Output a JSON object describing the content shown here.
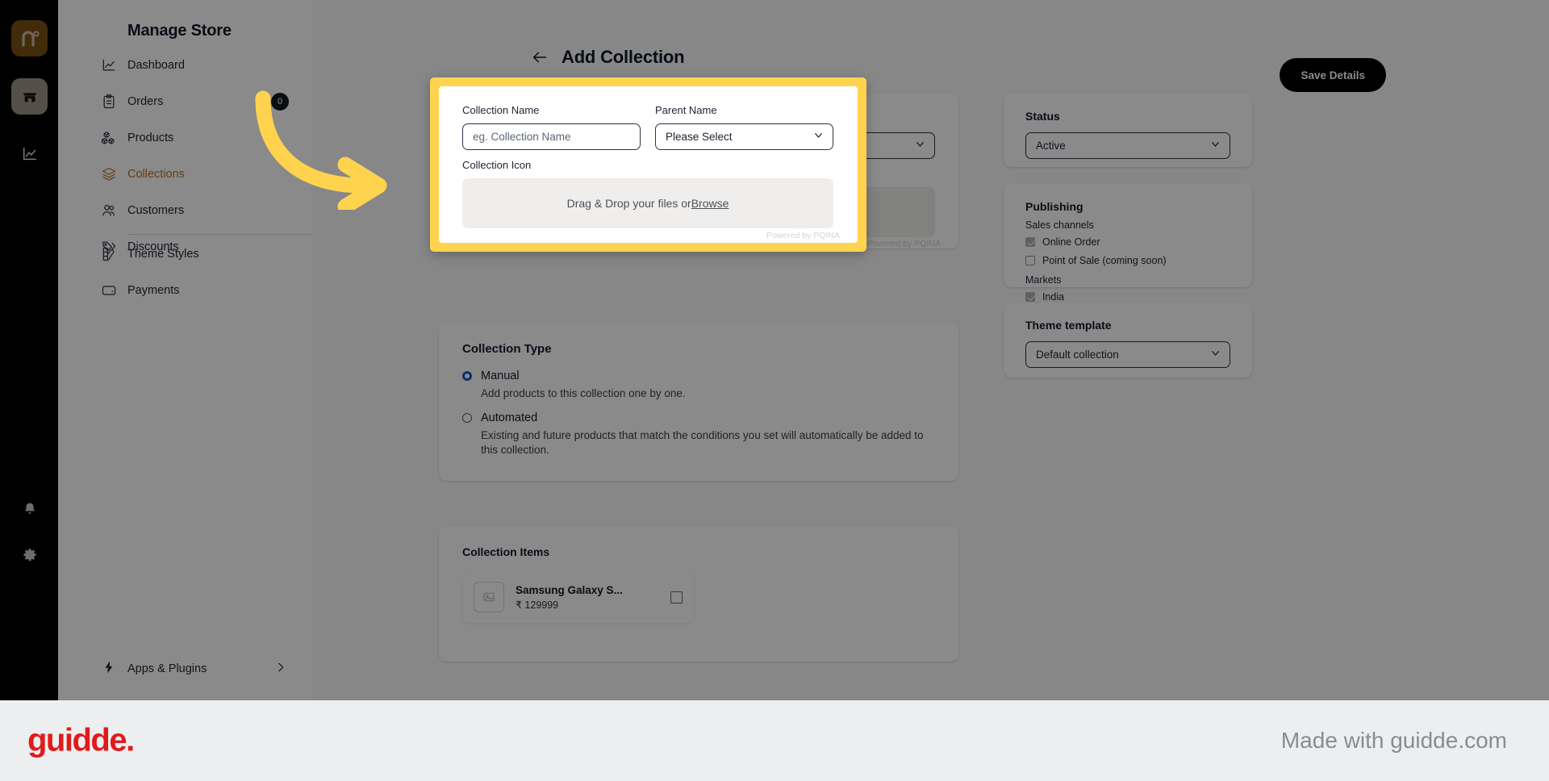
{
  "rail": {
    "logo_icon": "brand-n-icon",
    "items": [
      {
        "name": "store-icon",
        "label": "Store"
      },
      {
        "name": "analytics-icon",
        "label": "Analytics"
      },
      {
        "name": "bell-icon",
        "label": "Notifications"
      },
      {
        "name": "gear-icon",
        "label": "Settings"
      }
    ]
  },
  "sidebar": {
    "title": "Manage Store",
    "items": [
      {
        "label": "Dashboard",
        "icon": "chart-line-icon",
        "badge": "",
        "active": false
      },
      {
        "label": "Orders",
        "icon": "clipboard-icon",
        "badge": "0",
        "active": false
      },
      {
        "label": "Products",
        "icon": "boxes-icon",
        "badge": "",
        "active": false
      },
      {
        "label": "Collections",
        "icon": "layers-icon",
        "badge": "",
        "active": true
      },
      {
        "label": "Customers",
        "icon": "users-icon",
        "badge": "",
        "active": false
      },
      {
        "label": "Discounts",
        "icon": "tag-icon",
        "badge": "",
        "active": false
      }
    ],
    "lower_items": [
      {
        "label": "Theme Styles",
        "icon": "palette-icon"
      },
      {
        "label": "Payments",
        "icon": "wallet-icon"
      }
    ],
    "apps_plugins": {
      "label": "Apps & Plugins",
      "icon": "bolt-icon",
      "chevron": "chevron-right-icon"
    }
  },
  "header": {
    "back_icon": "arrow-left-icon",
    "title": "Add Collection",
    "save_label": "Save Details"
  },
  "basic": {
    "collection_name_label": "Collection Name",
    "collection_name_value": "",
    "collection_name_placeholder": "eg. Collection Name",
    "parent_name_label": "Parent Name",
    "parent_name_value": "Please Select",
    "parent_name_options": [
      "Please Select"
    ],
    "collection_icon_label": "Collection Icon",
    "dropzone_text": "Drag & Drop your files or ",
    "dropzone_browse": "Browse",
    "powered_by": "Powered by PQINA"
  },
  "collection_type": {
    "title": "Collection Type",
    "options": [
      {
        "label": "Manual",
        "description": "Add products to this collection one by one.",
        "selected": true
      },
      {
        "label": "Automated",
        "description": "Existing and future products that match the conditions you set will automatically be added to this collection.",
        "selected": false
      }
    ]
  },
  "collection_items": {
    "title": "Collection Items",
    "items": [
      {
        "name": "Samsung Galaxy S...",
        "price": "₹ 129999",
        "thumb_icon": "image-placeholder-icon",
        "checked": false
      }
    ]
  },
  "right_panel": {
    "status": {
      "title": "Status",
      "value": "Active",
      "options": [
        "Active"
      ]
    },
    "publishing": {
      "title": "Publishing",
      "sales_channels_label": "Sales channels",
      "sales_channels": [
        {
          "label": "Online Order",
          "checked": true
        },
        {
          "label": "Point of Sale (coming soon)",
          "checked": false
        }
      ],
      "markets_label": "Markets",
      "markets": [
        {
          "label": "India",
          "checked": true
        }
      ]
    },
    "theme_template": {
      "title": "Theme template",
      "value": "Default collection",
      "options": [
        "Default collection"
      ]
    }
  },
  "annotation": {
    "highlight_color": "#FFD34E",
    "arrow_icon": "curved-arrow-icon"
  },
  "footer": {
    "logo_text": "guidde.",
    "made_with": "Made with guidde.com",
    "logo_color": "#e01b1b"
  }
}
